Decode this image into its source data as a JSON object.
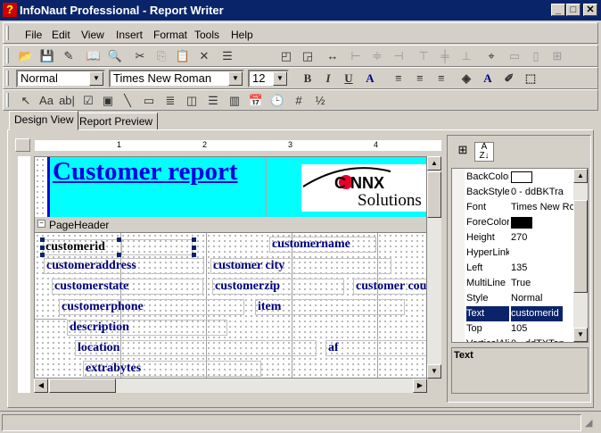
{
  "window": {
    "title": "InfoNaut Professional - Report Writer",
    "app_icon": "?"
  },
  "menu": [
    "File",
    "Edit",
    "View",
    "Insert",
    "Format",
    "Tools",
    "Help"
  ],
  "toolbar1": [
    {
      "name": "open-icon",
      "g": "📂"
    },
    {
      "name": "save-icon",
      "g": "💾"
    },
    {
      "name": "save-as-icon",
      "g": "✎"
    },
    {
      "name": "book-icon",
      "g": "📖"
    },
    {
      "name": "print-preview-icon",
      "g": "🔍"
    },
    {
      "name": "cut-icon",
      "g": "✂"
    },
    {
      "name": "copy-icon",
      "g": "⎘"
    },
    {
      "name": "paste-icon",
      "g": "📋"
    },
    {
      "name": "delete-icon",
      "g": "✕"
    },
    {
      "name": "sections-icon",
      "g": "☰"
    },
    {
      "name": "bring-to-front-icon",
      "g": "◰"
    },
    {
      "name": "send-to-back-icon",
      "g": "◲"
    },
    {
      "name": "same-width-icon",
      "g": "↔"
    },
    {
      "name": "align-left-icon",
      "g": "⊢"
    },
    {
      "name": "align-center-icon",
      "g": "≑"
    },
    {
      "name": "align-right-icon",
      "g": "⊣"
    },
    {
      "name": "align-top-icon",
      "g": "⊤"
    },
    {
      "name": "align-middle-icon",
      "g": "╪"
    },
    {
      "name": "align-bottom-icon",
      "g": "⊥"
    },
    {
      "name": "center-icon",
      "g": "⌖"
    },
    {
      "name": "space-horizontal-icon",
      "g": "▭"
    },
    {
      "name": "space-vertical-icon",
      "g": "▯"
    },
    {
      "name": "grid-icon",
      "g": "⊞"
    }
  ],
  "format": {
    "style": "Normal",
    "font": "Times New Roman",
    "size": "12"
  },
  "toolbar2": [
    {
      "name": "bold-icon",
      "g": "B"
    },
    {
      "name": "italic-icon",
      "g": "I"
    },
    {
      "name": "underline-icon",
      "g": "U"
    },
    {
      "name": "font-color-a-icon",
      "g": "A"
    },
    {
      "name": "text-align-left-icon",
      "g": "≡"
    },
    {
      "name": "text-align-center-icon",
      "g": "≡"
    },
    {
      "name": "text-align-right-icon",
      "g": "≡"
    },
    {
      "name": "fill-color-icon",
      "g": "◈"
    },
    {
      "name": "fore-color-icon",
      "g": "A"
    },
    {
      "name": "line-color-icon",
      "g": "✐"
    },
    {
      "name": "border-icon",
      "g": "⬚"
    }
  ],
  "toolbar3": [
    {
      "name": "pointer-icon",
      "g": "↖"
    },
    {
      "name": "label-icon",
      "g": "Aa"
    },
    {
      "name": "textbox-icon",
      "g": "ab|"
    },
    {
      "name": "checkbox-icon",
      "g": "☑"
    },
    {
      "name": "image-icon",
      "g": "▣"
    },
    {
      "name": "line-icon",
      "g": "╲"
    },
    {
      "name": "rectangle-icon",
      "g": "▭"
    },
    {
      "name": "richtext-icon",
      "g": "≣"
    },
    {
      "name": "subreport-icon",
      "g": "◫"
    },
    {
      "name": "pagebreak-icon",
      "g": "☰"
    },
    {
      "name": "barcode-icon",
      "g": "▥"
    },
    {
      "name": "calendar-icon",
      "g": "📅"
    },
    {
      "name": "clock-icon",
      "g": "🕒"
    },
    {
      "name": "page-number-icon",
      "g": "#"
    },
    {
      "name": "page-count-icon",
      "g": "½"
    }
  ],
  "tabs": [
    "Design View",
    "Report Preview"
  ],
  "ruler": [
    "1",
    "2",
    "3",
    "4"
  ],
  "report": {
    "title": "Customer report",
    "logo": "CONNX Solutions",
    "section": "PageHeader",
    "fields": [
      "customerid",
      "customername",
      "customeraddress",
      "customer city",
      "customerstate",
      "customerzip",
      "customer cou",
      "customerphone",
      "item",
      "description",
      "location",
      "af",
      "extrabytes"
    ]
  },
  "properties": {
    "rows": [
      {
        "n": "BackColor",
        "v": ""
      },
      {
        "n": "BackStyle",
        "v": "0 - ddBKTra"
      },
      {
        "n": "Font",
        "v": "Times New Ro"
      },
      {
        "n": "ForeColor",
        "v": ""
      },
      {
        "n": "Height",
        "v": "270"
      },
      {
        "n": "HyperLink",
        "v": ""
      },
      {
        "n": "Left",
        "v": "135"
      },
      {
        "n": "MultiLine",
        "v": "True"
      },
      {
        "n": "Style",
        "v": "Normal"
      },
      {
        "n": "Text",
        "v": "customerid"
      },
      {
        "n": "Top",
        "v": "105"
      },
      {
        "n": "VerticalAli",
        "v": "0 - ddTXTop"
      }
    ],
    "selected": "Text",
    "description": "Text"
  },
  "colors": {
    "title_bar": "#0a246a",
    "header_bg": "#00ffff",
    "field_text": "#00007f"
  }
}
